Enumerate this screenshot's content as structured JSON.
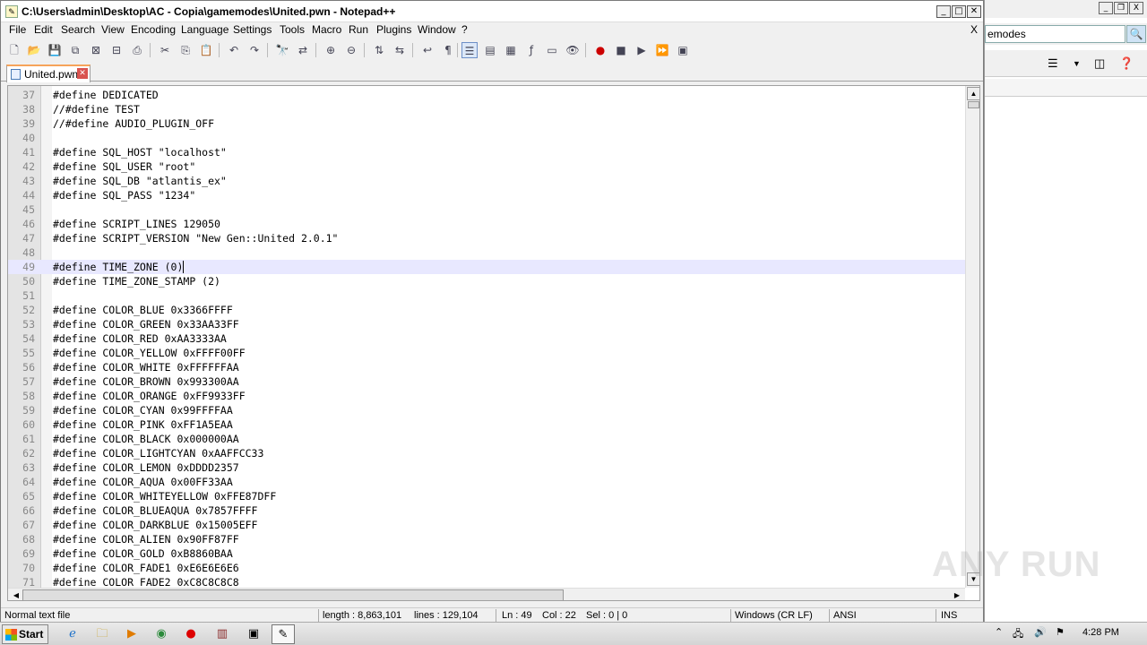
{
  "background_window": {
    "address_text": "emodes",
    "controls": [
      "_",
      "❐",
      "X"
    ]
  },
  "window": {
    "title": "C:\\Users\\admin\\Desktop\\AC - Copia\\gamemodes\\United.pwn - Notepad++",
    "close_doc": "X"
  },
  "menu": [
    "File",
    "Edit",
    "Search",
    "View",
    "Encoding",
    "Language",
    "Settings",
    "Tools",
    "Macro",
    "Run",
    "Plugins",
    "Window",
    "?"
  ],
  "tab": {
    "label": "United.pwn"
  },
  "editor": {
    "lines": [
      {
        "n": "37",
        "t": "#define DEDICATED"
      },
      {
        "n": "38",
        "t": "//#define TEST"
      },
      {
        "n": "39",
        "t": "//#define AUDIO_PLUGIN_OFF"
      },
      {
        "n": "40",
        "t": ""
      },
      {
        "n": "41",
        "t": "#define SQL_HOST \"localhost\""
      },
      {
        "n": "42",
        "t": "#define SQL_USER \"root\""
      },
      {
        "n": "43",
        "t": "#define SQL_DB \"atlantis_ex\""
      },
      {
        "n": "44",
        "t": "#define SQL_PASS \"1234\""
      },
      {
        "n": "45",
        "t": ""
      },
      {
        "n": "46",
        "t": "#define SCRIPT_LINES 129050"
      },
      {
        "n": "47",
        "t": "#define SCRIPT_VERSION \"New Gen::United 2.0.1\""
      },
      {
        "n": "48",
        "t": ""
      },
      {
        "n": "49",
        "t": "#define TIME_ZONE (0)"
      },
      {
        "n": "50",
        "t": "#define TIME_ZONE_STAMP (2)"
      },
      {
        "n": "51",
        "t": ""
      },
      {
        "n": "52",
        "t": "#define COLOR_BLUE 0x3366FFFF"
      },
      {
        "n": "53",
        "t": "#define COLOR_GREEN 0x33AA33FF"
      },
      {
        "n": "54",
        "t": "#define COLOR_RED 0xAA3333AA"
      },
      {
        "n": "55",
        "t": "#define COLOR_YELLOW 0xFFFF00FF"
      },
      {
        "n": "56",
        "t": "#define COLOR_WHITE 0xFFFFFFAA"
      },
      {
        "n": "57",
        "t": "#define COLOR_BROWN 0x993300AA"
      },
      {
        "n": "58",
        "t": "#define COLOR_ORANGE 0xFF9933FF"
      },
      {
        "n": "59",
        "t": "#define COLOR_CYAN 0x99FFFFAA"
      },
      {
        "n": "60",
        "t": "#define COLOR_PINK 0xFF1A5EAA"
      },
      {
        "n": "61",
        "t": "#define COLOR_BLACK 0x000000AA"
      },
      {
        "n": "62",
        "t": "#define COLOR_LIGHTCYAN 0xAAFFCC33"
      },
      {
        "n": "63",
        "t": "#define COLOR_LEMON 0xDDDD2357"
      },
      {
        "n": "64",
        "t": "#define COLOR_AQUA 0x00FF33AA"
      },
      {
        "n": "65",
        "t": "#define COLOR_WHITEYELLOW 0xFFE87DFF"
      },
      {
        "n": "66",
        "t": "#define COLOR_BLUEAQUA 0x7857FFFF"
      },
      {
        "n": "67",
        "t": "#define COLOR_DARKBLUE 0x15005EFF"
      },
      {
        "n": "68",
        "t": "#define COLOR_ALIEN 0x90FF87FF"
      },
      {
        "n": "69",
        "t": "#define COLOR_GOLD 0xB8860BAA"
      },
      {
        "n": "70",
        "t": "#define COLOR_FADE1 0xE6E6E6E6"
      },
      {
        "n": "71",
        "t": "#define COLOR_FADE2 0xC8C8C8C8"
      }
    ],
    "current_line": "49"
  },
  "status": {
    "file_type": "Normal text file",
    "length": "length : 8,863,101",
    "lines": "lines : 129,104",
    "ln": "Ln : 49",
    "col": "Col : 22",
    "sel": "Sel : 0 | 0",
    "eol": "Windows (CR LF)",
    "encoding": "ANSI",
    "mode": "INS"
  },
  "taskbar": {
    "start_label": "Start",
    "clock": "4:28 PM"
  },
  "watermark": "ANY RUN"
}
